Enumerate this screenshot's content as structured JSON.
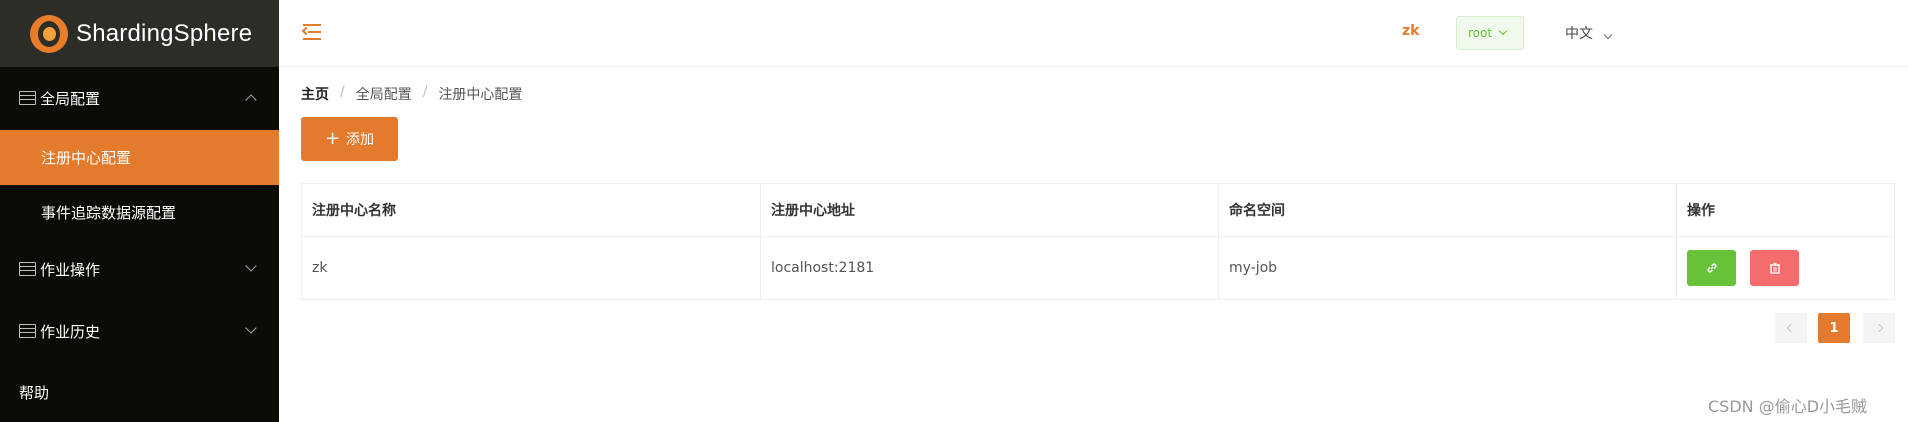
{
  "brand": {
    "name": "ShardingSphere"
  },
  "sidebar": {
    "groups": [
      {
        "label": "全局配置",
        "expanded": true,
        "icon": "list-icon"
      },
      {
        "label": "作业操作",
        "expanded": false,
        "icon": "list-icon"
      },
      {
        "label": "作业历史",
        "expanded": false,
        "icon": "list-icon"
      }
    ],
    "submenu": [
      {
        "label": "注册中心配置",
        "active": true
      },
      {
        "label": "事件追踪数据源配置",
        "active": false
      }
    ],
    "help": "帮助"
  },
  "header": {
    "registry": "zk",
    "user": "root",
    "language": "中文"
  },
  "breadcrumb": [
    "主页",
    "全局配置",
    "注册中心配置"
  ],
  "toolbar": {
    "add_label": "添加"
  },
  "table": {
    "columns": [
      "注册中心名称",
      "注册中心地址",
      "命名空间",
      "操作"
    ],
    "rows": [
      {
        "name": "zk",
        "address": "localhost:2181",
        "namespace": "my-job"
      }
    ]
  },
  "pagination": {
    "current_page": "1"
  },
  "watermark": "CSDN @偷心D小毛贼",
  "colors": {
    "accent": "#e47a2c",
    "success": "#67c23a",
    "danger": "#f56c6c",
    "sidebar_bg": "#0c0c06"
  }
}
